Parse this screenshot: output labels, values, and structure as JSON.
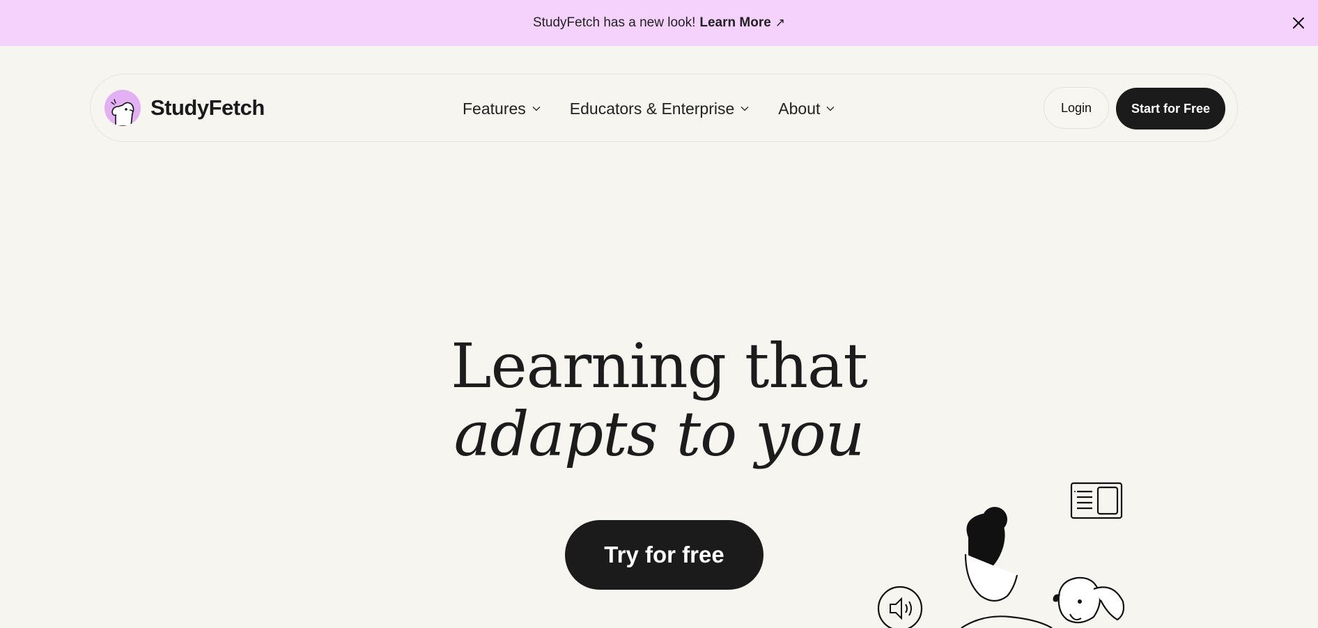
{
  "banner": {
    "message": "StudyFetch has a new look!",
    "link_label": "Learn More",
    "link_arrow": "↗",
    "close_icon": "close-icon"
  },
  "nav": {
    "brand": "StudyFetch",
    "menu": [
      {
        "label": "Features",
        "icon": "chevron-down-icon"
      },
      {
        "label": "Educators & Enterprise",
        "icon": "chevron-down-icon"
      },
      {
        "label": "About",
        "icon": "chevron-down-icon"
      }
    ],
    "login_label": "Login",
    "start_label": "Start for Free"
  },
  "hero": {
    "line1": "Learning that",
    "line2": "adapts to you",
    "cta_label": "Try for free"
  },
  "colors": {
    "background": "#f6f5ef",
    "banner": "#f5d2fc",
    "logo_badge": "#e2b0f3",
    "button_dark": "#1b1b1b"
  }
}
